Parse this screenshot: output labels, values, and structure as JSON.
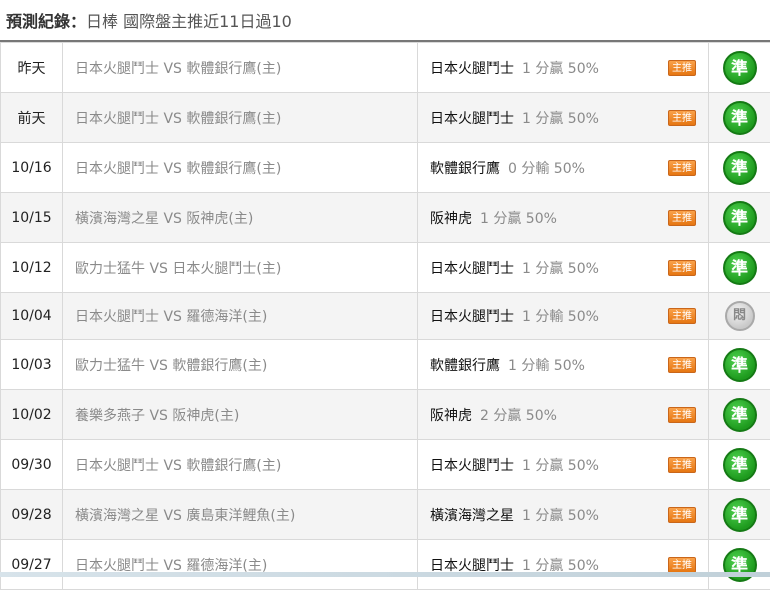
{
  "header": {
    "label": "預測紀錄：",
    "text": "日棒 國際盤主推近11日過10"
  },
  "rows": [
    {
      "date": "昨天",
      "match": "日本火腿鬥士 VS 軟體銀行鷹(主)",
      "pick_team": "日本火腿鬥士",
      "pick_odds": "1 分贏 50%",
      "badge": "主推",
      "result": "準",
      "status": "win"
    },
    {
      "date": "前天",
      "match": "日本火腿鬥士 VS 軟體銀行鷹(主)",
      "pick_team": "日本火腿鬥士",
      "pick_odds": "1 分贏 50%",
      "badge": "主推",
      "result": "準",
      "status": "win"
    },
    {
      "date": "10/16",
      "match": "日本火腿鬥士 VS 軟體銀行鷹(主)",
      "pick_team": "軟體銀行鷹",
      "pick_odds": "0 分輸 50%",
      "badge": "主推",
      "result": "準",
      "status": "win"
    },
    {
      "date": "10/15",
      "match": "橫濱海灣之星 VS 阪神虎(主)",
      "pick_team": "阪神虎",
      "pick_odds": "1 分贏 50%",
      "badge": "主推",
      "result": "準",
      "status": "win"
    },
    {
      "date": "10/12",
      "match": "歐力士猛牛 VS 日本火腿鬥士(主)",
      "pick_team": "日本火腿鬥士",
      "pick_odds": "1 分贏 50%",
      "badge": "主推",
      "result": "準",
      "status": "win"
    },
    {
      "date": "10/04",
      "match": "日本火腿鬥士 VS 羅德海洋(主)",
      "pick_team": "日本火腿鬥士",
      "pick_odds": "1 分輸 50%",
      "badge": "主推",
      "result": "悶",
      "status": "pending"
    },
    {
      "date": "10/03",
      "match": "歐力士猛牛 VS 軟體銀行鷹(主)",
      "pick_team": "軟體銀行鷹",
      "pick_odds": "1 分輸 50%",
      "badge": "主推",
      "result": "準",
      "status": "win"
    },
    {
      "date": "10/02",
      "match": "養樂多燕子 VS 阪神虎(主)",
      "pick_team": "阪神虎",
      "pick_odds": "2 分贏 50%",
      "badge": "主推",
      "result": "準",
      "status": "win"
    },
    {
      "date": "09/30",
      "match": "日本火腿鬥士 VS 軟體銀行鷹(主)",
      "pick_team": "日本火腿鬥士",
      "pick_odds": "1 分贏 50%",
      "badge": "主推",
      "result": "準",
      "status": "win"
    },
    {
      "date": "09/28",
      "match": "橫濱海灣之星 VS 廣島東洋鯉魚(主)",
      "pick_team": "橫濱海灣之星",
      "pick_odds": "1 分贏 50%",
      "badge": "主推",
      "result": "準",
      "status": "win"
    },
    {
      "date": "09/27",
      "match": "日本火腿鬥士 VS 羅德海洋(主)",
      "pick_team": "日本火腿鬥士",
      "pick_odds": "1 分贏 50%",
      "badge": "主推",
      "result": "準",
      "status": "win"
    }
  ],
  "colors": {
    "win": "#1e9a1e",
    "pending": "#c9c9c9",
    "badge": "#e67612"
  }
}
